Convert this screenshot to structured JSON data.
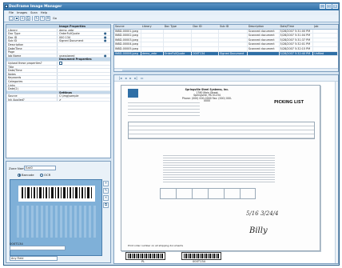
{
  "window": {
    "title": "DocFrame Image Manager"
  },
  "menu": [
    "File",
    "Images",
    "Scan",
    "Help"
  ],
  "toolbar": {
    "text": "Go"
  },
  "properties": {
    "section1": "Image Properties",
    "rows1": [
      {
        "k": "Library",
        "v": "demo_zebr"
      },
      {
        "k": "Doc Type",
        "v": "OrderFullQuote"
      },
      {
        "k": "Doc ID",
        "v": "000 134"
      },
      {
        "k": "Sub ID",
        "v": "Signed Document"
      },
      {
        "k": "Description",
        "v": ""
      },
      {
        "k": "Date/Time",
        "v": ""
      },
      {
        "k": "Page",
        "v": ""
      },
      {
        "k": "Job Name",
        "v": "unassigned"
      }
    ],
    "section2": "Document Properties",
    "rows2": [
      {
        "k": "Upload these properties?",
        "v": ""
      },
      {
        "k": "Title",
        "v": ""
      },
      {
        "k": "Date/Time",
        "v": ""
      },
      {
        "k": "Notes",
        "v": ""
      },
      {
        "k": "Keywords",
        "v": ""
      },
      {
        "k": "Categories",
        "v": ""
      },
      {
        "k": "Links",
        "v": ""
      },
      {
        "k": "Date(2)",
        "v": ""
      }
    ],
    "section3": "Settings",
    "rows3": [
      {
        "k": "Source",
        "v": "C:\\img\\sample"
      },
      {
        "k": "Ink Applied?",
        "v": ""
      }
    ]
  },
  "zone": {
    "name_label": "Zone Name",
    "name_value": "Ezd0",
    "radio1": "Barcode",
    "radio2": "OCR",
    "code_label": "000T134",
    "select_value": "Any Field"
  },
  "table": {
    "headers": [
      "Source",
      "Library",
      "Doc Type",
      "Doc ID",
      "Sub ID",
      "Description",
      "Date/Time",
      "Job"
    ],
    "rows": [
      [
        "INBD-00001.jpeg",
        "",
        "",
        "",
        "",
        "Scanned document",
        "5/28/2007 5:31:00 PM",
        ""
      ],
      [
        "INBD-00002.jpeg",
        "",
        "",
        "",
        "",
        "Scanned document",
        "5/28/2007 5:31:04 PM",
        ""
      ],
      [
        "INBD-00003.jpeg",
        "",
        "",
        "",
        "",
        "Scanned document",
        "5/28/2007 5:31:37 PM",
        ""
      ],
      [
        "INBD-00004.jpeg",
        "",
        "",
        "",
        "",
        "Scanned document",
        "5/28/2007 5:32:01 PM",
        ""
      ],
      [
        "INBD-00005.jpeg",
        "",
        "",
        "",
        "",
        "Scanned document",
        "5/28/2007 5:32:15 PM",
        ""
      ],
      [
        "INBD-00006.jpeg",
        "demo_zebr",
        "OrderFullQuote",
        "000T134",
        "Signed Document",
        "",
        "5/28/2007 5:32:40 PM",
        "Unfiled"
      ]
    ]
  },
  "document": {
    "company": "Springville Steel Systems, Inc.",
    "addr1": "1780 Main Street",
    "addr2": "Springville, PA 01234",
    "phone": "Phone: (000) 000-0000  Fax: (000) 000-0000",
    "title": "PICKING LIST",
    "signature": "Billy",
    "date": "5/16  3/24/4",
    "footer": "Print order number on all shipping documents",
    "barcode1": "PL",
    "barcode2": "000T134"
  },
  "colors": {
    "accent": "#2f6fa6",
    "frame": "#d8e6f2",
    "panel": "#7fb0d8"
  }
}
